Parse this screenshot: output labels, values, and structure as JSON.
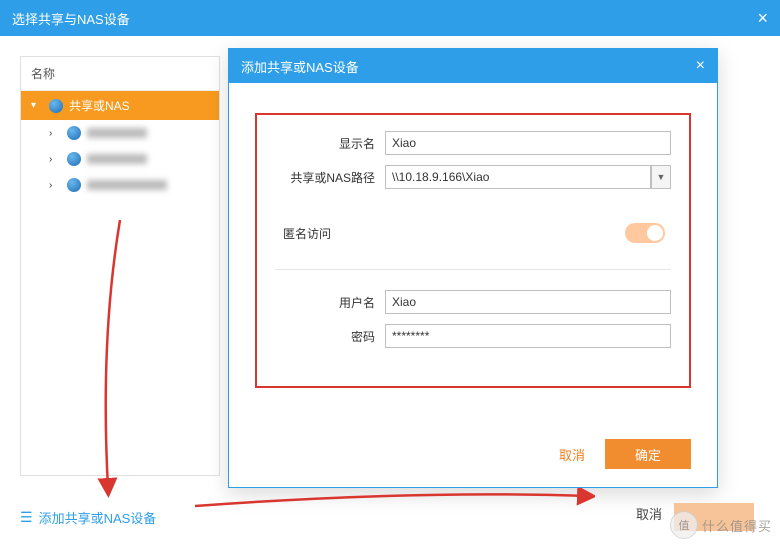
{
  "main": {
    "title": "选择共享与NAS设备"
  },
  "sidebar": {
    "header": "名称",
    "root_label": "共享或NAS"
  },
  "addLink": {
    "label": "添加共享或NAS设备"
  },
  "dialog": {
    "title": "添加共享或NAS设备",
    "fields": {
      "display_name_label": "显示名",
      "display_name_value": "Xiao",
      "path_label": "共享或NAS路径",
      "path_value": "\\\\10.18.9.166\\Xiao",
      "anon_label": "匿名访问",
      "username_label": "用户名",
      "username_value": "Xiao",
      "password_label": "密码",
      "password_value": "********"
    },
    "cancel": "取消",
    "ok": "确定"
  },
  "outer": {
    "cancel": "取消"
  },
  "watermark": {
    "circ": "值",
    "txt": "什么值得买"
  }
}
